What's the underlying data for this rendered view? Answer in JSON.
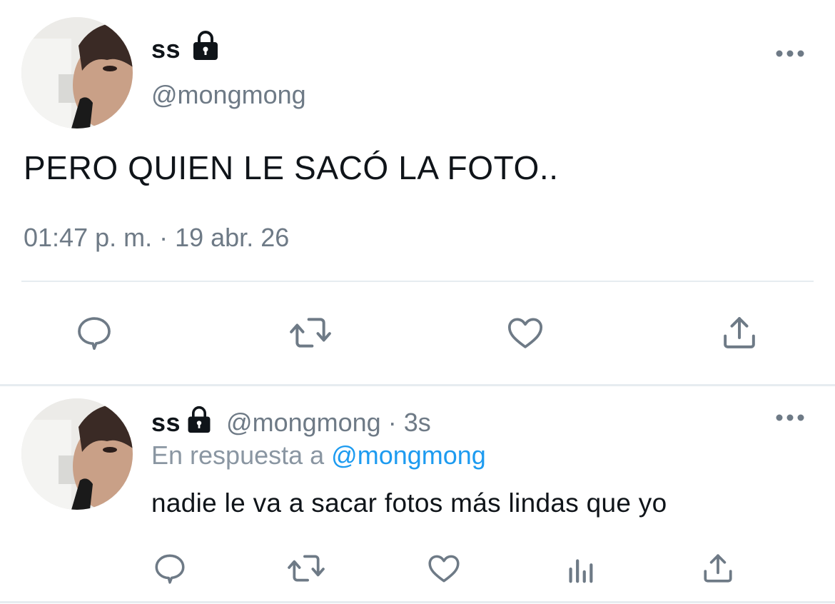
{
  "tweet": {
    "display_name": "ss",
    "handle": "@mongmong",
    "text": "PERO QUIEN LE SACÓ LA FOTO..",
    "timestamp": "01:47 p. m. · 19 abr. 26",
    "actions": [
      "reply-icon",
      "retweet-icon",
      "like-icon",
      "share-icon"
    ]
  },
  "reply": {
    "display_name": "ss",
    "handle": "@mongmong",
    "separator": " · ",
    "time": "3s",
    "in_reply_prefix": "En respuesta a ",
    "in_reply_mention": "@mongmong",
    "text": "nadie le va a sacar fotos más lindas que yo",
    "actions": [
      "reply-icon",
      "retweet-icon",
      "like-icon",
      "analytics-icon",
      "share-icon"
    ]
  },
  "colors": {
    "text": "#0f1419",
    "secondary": "#6e7a86",
    "mention": "#1d9bf0",
    "divider": "#e6ecf0"
  }
}
